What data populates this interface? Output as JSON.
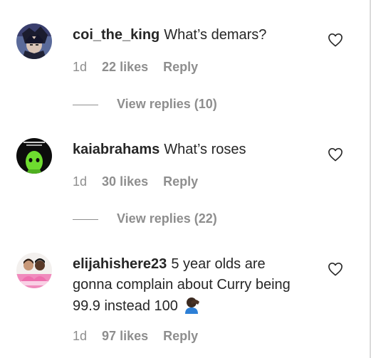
{
  "comments": [
    {
      "username": "coi_the_king",
      "text": "What’s demars?",
      "time": "1d",
      "likes": "22 likes",
      "reply_label": "Reply",
      "view_replies": "View replies (10)",
      "avatar_icon": "dark-anime-character-avatar"
    },
    {
      "username": "kaiabrahams",
      "text": "What’s roses",
      "time": "1d",
      "likes": "30 likes",
      "reply_label": "Reply",
      "view_replies": "View replies (22)",
      "avatar_icon": "green-masked-figure-avatar"
    },
    {
      "username": "elijahishere23",
      "text": "5 year olds are gonna complain about Curry being 99.9 instead 100",
      "emoji": "facepalm-emoji",
      "time": "1d",
      "likes": "97 likes",
      "reply_label": "Reply",
      "avatar_icon": "two-people-pink-background-avatar"
    }
  ],
  "colors": {
    "text": "#262626",
    "secondary": "#8e8e8e",
    "border": "#dbdbdb"
  }
}
